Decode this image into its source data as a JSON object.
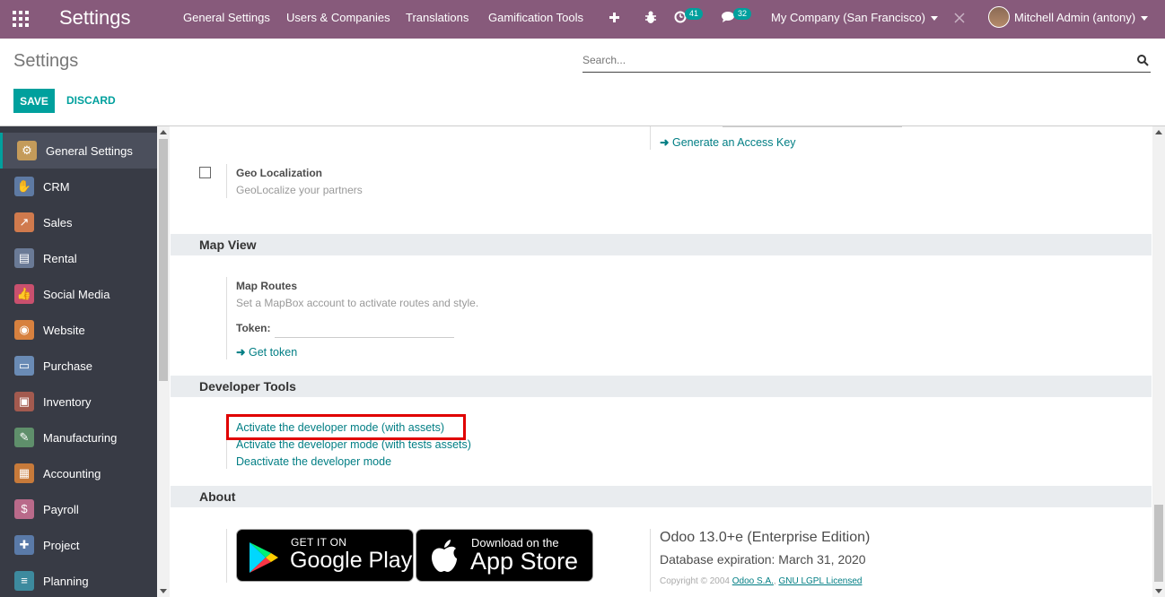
{
  "navbar": {
    "app_title": "Settings",
    "menu": [
      "General Settings",
      "Users & Companies",
      "Translations",
      "Gamification Tools"
    ],
    "activity_badge": "41",
    "messages_badge": "32",
    "company": "My Company (San Francisco)",
    "user": "Mitchell Admin (antony)"
  },
  "control_panel": {
    "title": "Settings",
    "search_placeholder": "Search...",
    "save_label": "SAVE",
    "discard_label": "DISCARD"
  },
  "sidebar": {
    "items": [
      {
        "label": "General Settings",
        "color": "#c49b5a",
        "icon": "gear-icon"
      },
      {
        "label": "CRM",
        "color": "#5e7aa3",
        "icon": "handshake-icon"
      },
      {
        "label": "Sales",
        "color": "#d07a4d",
        "icon": "chart-icon"
      },
      {
        "label": "Rental",
        "color": "#6a7a96",
        "icon": "rental-icon"
      },
      {
        "label": "Social Media",
        "color": "#c9506e",
        "icon": "thumbs-up-icon"
      },
      {
        "label": "Website",
        "color": "#d7813f",
        "icon": "globe-icon"
      },
      {
        "label": "Purchase",
        "color": "#6a8bb5",
        "icon": "card-icon"
      },
      {
        "label": "Inventory",
        "color": "#a35a4f",
        "icon": "box-icon"
      },
      {
        "label": "Manufacturing",
        "color": "#5f8f6b",
        "icon": "wrench-icon"
      },
      {
        "label": "Accounting",
        "color": "#c77a3a",
        "icon": "ledger-icon"
      },
      {
        "label": "Payroll",
        "color": "#b96a8a",
        "icon": "payroll-icon"
      },
      {
        "label": "Project",
        "color": "#5a7aa8",
        "icon": "puzzle-icon"
      },
      {
        "label": "Planning",
        "color": "#3d8a9e",
        "icon": "planning-icon"
      }
    ]
  },
  "content": {
    "access_key_link": "Generate an Access Key",
    "geo_title": "Geo Localization",
    "geo_desc": "GeoLocalize your partners",
    "map_view_title": "Map View",
    "map_routes_title": "Map Routes",
    "map_routes_desc": "Set a MapBox account to activate routes and style.",
    "token_label": "Token:",
    "get_token_link": "Get token",
    "dev_tools_title": "Developer Tools",
    "dev_links": [
      "Activate the developer mode (with assets)",
      "Activate the developer mode (with tests assets)",
      "Deactivate the developer mode"
    ],
    "about_title": "About",
    "google_play": {
      "line1": "GET IT ON",
      "line2": "Google Play"
    },
    "app_store": {
      "line1": "Download on the",
      "line2": "App Store"
    },
    "version": "Odoo 13.0+e (Enterprise Edition)",
    "expiration": "Database expiration: March 31, 2020",
    "copyright": "Copyright © 2004",
    "odoo_link": "Odoo S.A.",
    "license_link": "GNU LGPL Licensed"
  }
}
